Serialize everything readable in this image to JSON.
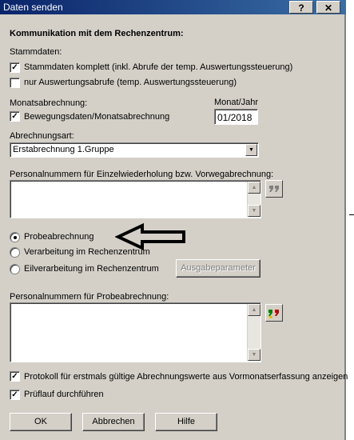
{
  "window": {
    "title": "Daten senden",
    "help_button": "?",
    "close_button": "✕"
  },
  "heading": "Kommunikation mit dem Rechenzentrum:",
  "stammdaten": {
    "label": "Stammdaten:",
    "option1": {
      "label": "Stammdaten komplett (inkl. Abrufe der temp. Auswertungssteuerung)",
      "checked": true
    },
    "option2": {
      "label": "nur Auswertungsabrufe (temp. Auswertungssteuerung)",
      "checked": false
    }
  },
  "monatsabrechnung": {
    "label": "Monatsabrechnung:",
    "checkbox": {
      "label": "Bewegungsdaten/Monatsabrechnung",
      "checked": true
    },
    "monat_label": "Monat/Jahr",
    "monat_value": "01/2018"
  },
  "abrechnungsart": {
    "label": "Abrechnungsart:",
    "selected": "Erstabrechnung 1.Gruppe"
  },
  "personal_einzel": {
    "label": "Personalnummern für Einzelwiederholung bzw. Vorwegabrechnung:",
    "value": ""
  },
  "modus": {
    "options": [
      {
        "label": "Probeabrechnung",
        "selected": true
      },
      {
        "label": "Verarbeitung im Rechenzentrum",
        "selected": false
      },
      {
        "label": "Eilverarbeitung im Rechenzentrum",
        "selected": false
      }
    ],
    "ausgabe_button": "Ausgabeparameter"
  },
  "personal_probe": {
    "label": "Personalnummern für Probeabrechnung:",
    "value": ""
  },
  "protokoll": {
    "label": "Protokoll für erstmals gültige Abrechnungswerte aus Vormonatserfassung anzeigen",
    "checked": true
  },
  "pruflauf": {
    "label": "Prüflauf durchführen",
    "checked": true
  },
  "buttons": {
    "ok": "OK",
    "cancel": "Abbrechen",
    "help": "Hilfe"
  },
  "colors": {
    "titlebar": "#0a246a",
    "face": "#d4d0c8",
    "arrow": "#000000"
  }
}
